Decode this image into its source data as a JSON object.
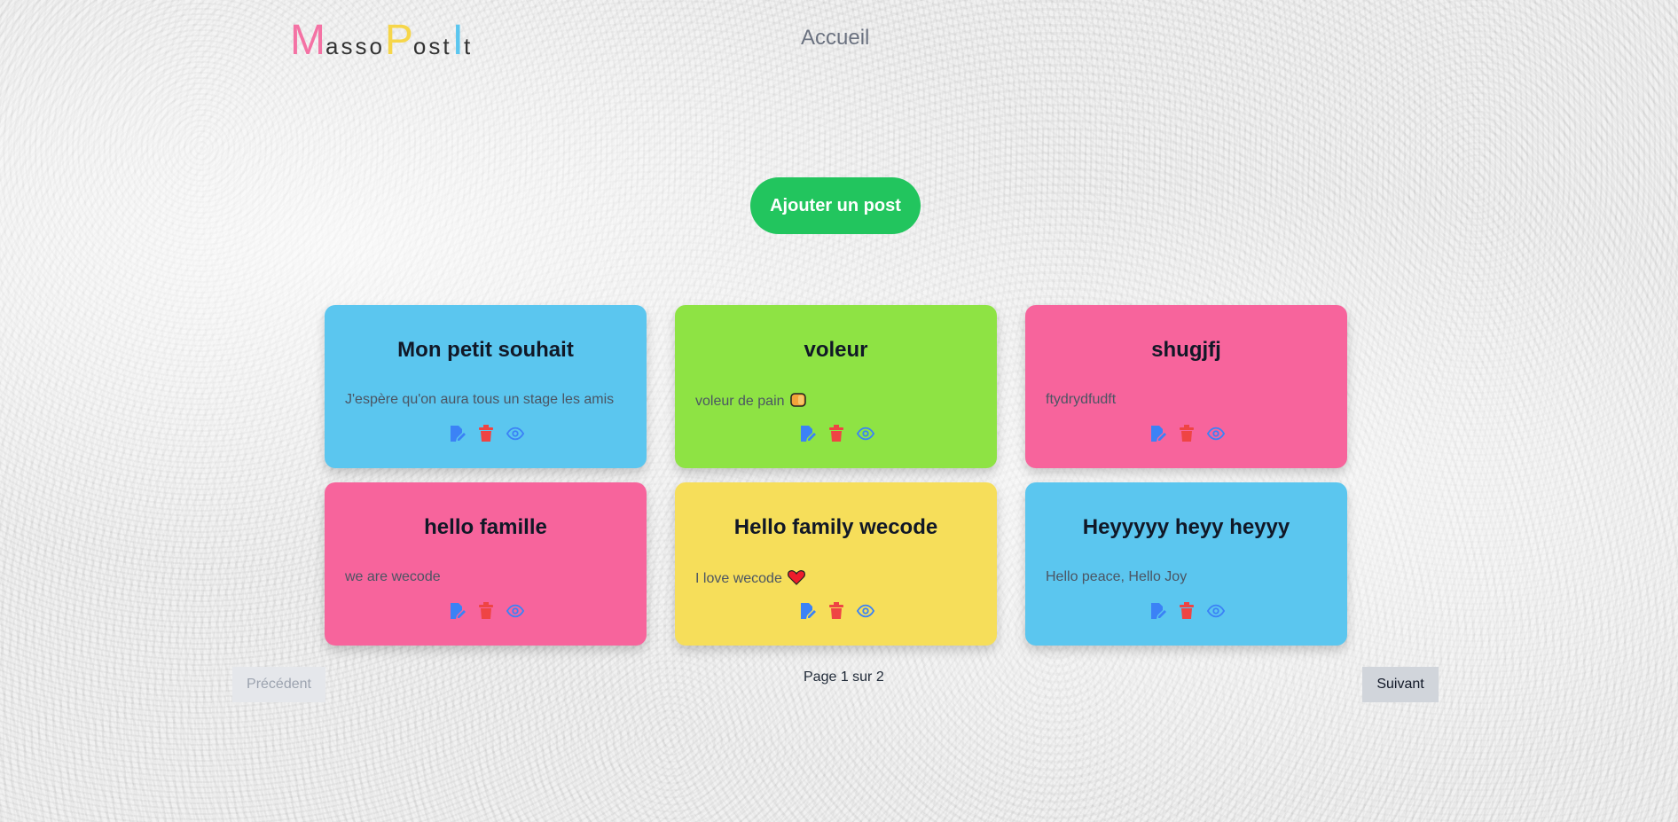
{
  "header": {
    "logo": {
      "m": "M",
      "asso": "asso",
      "p": "P",
      "ost": "ost",
      "i": "I",
      "t": "t"
    },
    "nav_home": "Accueil"
  },
  "actions": {
    "add_post": "Ajouter un post"
  },
  "colors": {
    "blue": "#5bc6ef",
    "green": "#8ee344",
    "pink": "#f7649c",
    "yellow": "#f6de5a",
    "edit_icon": "#3b82f6",
    "delete_icon": "#ef4444",
    "view_icon": "#3b82f6",
    "add_button": "#22c55e"
  },
  "posts": [
    {
      "title": "Mon petit souhait",
      "text": "J'espère qu'on aura tous un stage les amis",
      "emoji": "",
      "color": "blue"
    },
    {
      "title": "voleur",
      "text": "voleur de pain",
      "emoji": "bread-emoji",
      "color": "green"
    },
    {
      "title": "shugjfj",
      "text": "ftydrydfudft",
      "emoji": "",
      "color": "pink"
    },
    {
      "title": "hello famille",
      "text": "we are wecode",
      "emoji": "",
      "color": "pink"
    },
    {
      "title": "Hello family wecode",
      "text": "I love wecode",
      "emoji": "heart-emoji",
      "color": "yellow"
    },
    {
      "title": "Heyyyyy heyy heyyy",
      "text": "Hello peace, Hello Joy",
      "emoji": "",
      "color": "blue"
    }
  ],
  "pagination": {
    "prev_label": "Précédent",
    "next_label": "Suivant",
    "page_info": "Page 1 sur 2"
  }
}
